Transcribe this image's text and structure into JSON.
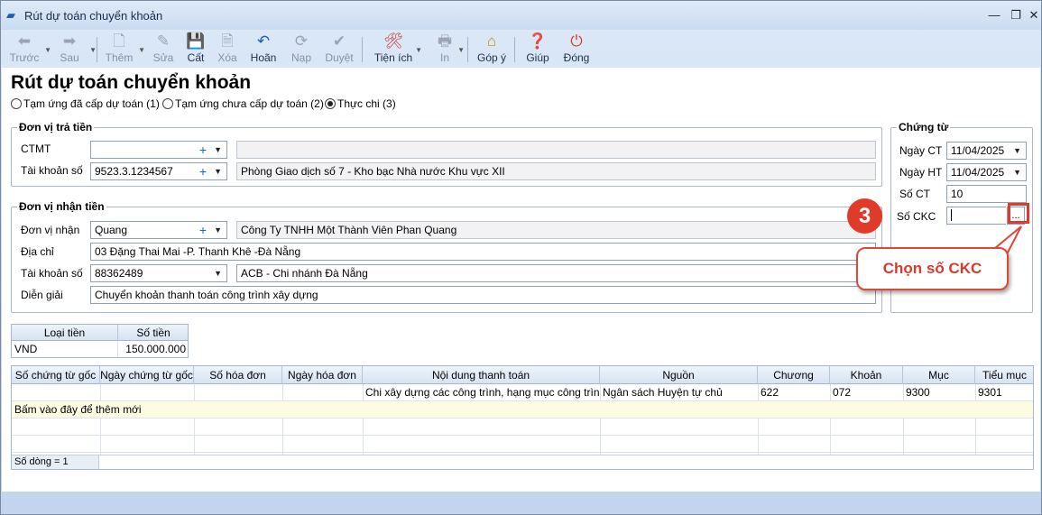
{
  "window": {
    "title": "Rút dự toán chuyển khoản"
  },
  "toolbar": {
    "back": "Trước",
    "next": "Sau",
    "add": "Thêm",
    "edit": "Sửa",
    "save": "Cất",
    "delete": "Xóa",
    "undo": "Hoãn",
    "reload": "Nạp",
    "approve": "Duyệt",
    "utilities": "Tiện ích",
    "print": "In",
    "feedback": "Góp ý",
    "help": "Giúp",
    "close": "Đóng"
  },
  "page": {
    "title": "Rút dự toán chuyển khoản",
    "radio1": "Tạm ứng đã cấp dự toán (1)",
    "radio2": "Tạm ứng chưa cấp dự toán (2)",
    "radio3": "Thực chi (3)"
  },
  "payer": {
    "legend": "Đơn vị trả tiền",
    "ctmt_label": "CTMT",
    "ctmt_value": "",
    "ctmt_desc": "",
    "account_label": "Tài khoản số",
    "account_value": "9523.3.1234567",
    "account_desc": "Phòng Giao dịch số 7 - Kho bạc Nhà nước Khu vực XII"
  },
  "payee": {
    "legend": "Đơn vị nhận tiền",
    "unit_label": "Đơn vị nhận",
    "unit_value": "Quang",
    "unit_desc": "Công Ty TNHH Một Thành Viên Phan Quang",
    "address_label": "Địa chỉ",
    "address_value": "03 Đặng Thai Mai -P. Thanh Khê -Đà Nẵng",
    "account_label": "Tài khoản số",
    "account_value": "88362489",
    "account_desc": "ACB - Chi nhánh Đà Nẵng",
    "desc_label": "Diễn giải",
    "desc_value": "Chuyển khoản thanh toán công trình xây dựng"
  },
  "voucher": {
    "legend": "Chứng từ",
    "date_ct_label": "Ngày CT",
    "date_ct": "11/04/2025",
    "date_ht_label": "Ngày HT",
    "date_ht": "11/04/2025",
    "no_ct_label": "Số CT",
    "no_ct": "10",
    "no_ckc_label": "Số CKC",
    "no_ckc": "",
    "browse": "..."
  },
  "callout": {
    "number": "3",
    "text": "Chọn số CKC"
  },
  "currency": {
    "headers": [
      "Loại tiền",
      "Số tiền"
    ],
    "row": {
      "type": "VND",
      "amount": "150.000.000"
    }
  },
  "details": {
    "headers": [
      "Số chứng từ gốc",
      "Ngày chứng từ gốc",
      "Số hóa đơn",
      "Ngày hóa đơn",
      "Nội dung thanh toán",
      "Nguồn",
      "Chương",
      "Khoản",
      "Mục",
      "Tiểu mục"
    ],
    "row": {
      "content": "Chi xây dựng các công trình, hạng mục công trình",
      "source": "Ngân sách Huyện tự chủ",
      "chapter": "622",
      "section": "072",
      "item": "9300",
      "subitem": "9301"
    },
    "add_row": "Bấm vào đây để thêm mới",
    "footer": "Số dòng = 1"
  }
}
